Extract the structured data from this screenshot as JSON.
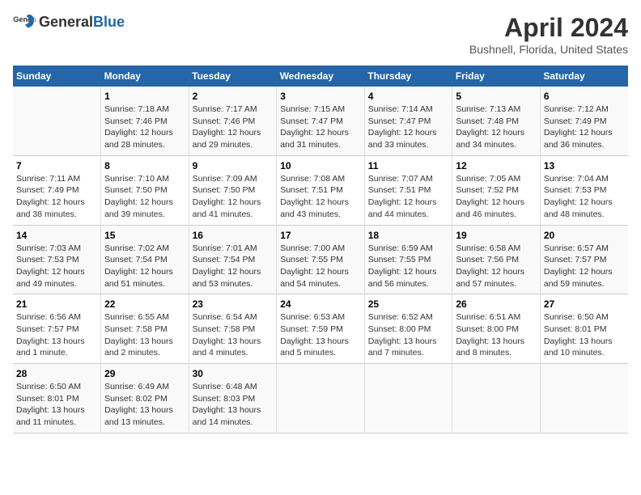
{
  "header": {
    "logo_general": "General",
    "logo_blue": "Blue",
    "title": "April 2024",
    "subtitle": "Bushnell, Florida, United States"
  },
  "days_of_week": [
    "Sunday",
    "Monday",
    "Tuesday",
    "Wednesday",
    "Thursday",
    "Friday",
    "Saturday"
  ],
  "weeks": [
    [
      {
        "day": "",
        "sunrise": "",
        "sunset": "",
        "daylight": ""
      },
      {
        "day": "1",
        "sunrise": "Sunrise: 7:18 AM",
        "sunset": "Sunset: 7:46 PM",
        "daylight": "Daylight: 12 hours and 28 minutes."
      },
      {
        "day": "2",
        "sunrise": "Sunrise: 7:17 AM",
        "sunset": "Sunset: 7:46 PM",
        "daylight": "Daylight: 12 hours and 29 minutes."
      },
      {
        "day": "3",
        "sunrise": "Sunrise: 7:15 AM",
        "sunset": "Sunset: 7:47 PM",
        "daylight": "Daylight: 12 hours and 31 minutes."
      },
      {
        "day": "4",
        "sunrise": "Sunrise: 7:14 AM",
        "sunset": "Sunset: 7:47 PM",
        "daylight": "Daylight: 12 hours and 33 minutes."
      },
      {
        "day": "5",
        "sunrise": "Sunrise: 7:13 AM",
        "sunset": "Sunset: 7:48 PM",
        "daylight": "Daylight: 12 hours and 34 minutes."
      },
      {
        "day": "6",
        "sunrise": "Sunrise: 7:12 AM",
        "sunset": "Sunset: 7:49 PM",
        "daylight": "Daylight: 12 hours and 36 minutes."
      }
    ],
    [
      {
        "day": "7",
        "sunrise": "Sunrise: 7:11 AM",
        "sunset": "Sunset: 7:49 PM",
        "daylight": "Daylight: 12 hours and 38 minutes."
      },
      {
        "day": "8",
        "sunrise": "Sunrise: 7:10 AM",
        "sunset": "Sunset: 7:50 PM",
        "daylight": "Daylight: 12 hours and 39 minutes."
      },
      {
        "day": "9",
        "sunrise": "Sunrise: 7:09 AM",
        "sunset": "Sunset: 7:50 PM",
        "daylight": "Daylight: 12 hours and 41 minutes."
      },
      {
        "day": "10",
        "sunrise": "Sunrise: 7:08 AM",
        "sunset": "Sunset: 7:51 PM",
        "daylight": "Daylight: 12 hours and 43 minutes."
      },
      {
        "day": "11",
        "sunrise": "Sunrise: 7:07 AM",
        "sunset": "Sunset: 7:51 PM",
        "daylight": "Daylight: 12 hours and 44 minutes."
      },
      {
        "day": "12",
        "sunrise": "Sunrise: 7:05 AM",
        "sunset": "Sunset: 7:52 PM",
        "daylight": "Daylight: 12 hours and 46 minutes."
      },
      {
        "day": "13",
        "sunrise": "Sunrise: 7:04 AM",
        "sunset": "Sunset: 7:53 PM",
        "daylight": "Daylight: 12 hours and 48 minutes."
      }
    ],
    [
      {
        "day": "14",
        "sunrise": "Sunrise: 7:03 AM",
        "sunset": "Sunset: 7:53 PM",
        "daylight": "Daylight: 12 hours and 49 minutes."
      },
      {
        "day": "15",
        "sunrise": "Sunrise: 7:02 AM",
        "sunset": "Sunset: 7:54 PM",
        "daylight": "Daylight: 12 hours and 51 minutes."
      },
      {
        "day": "16",
        "sunrise": "Sunrise: 7:01 AM",
        "sunset": "Sunset: 7:54 PM",
        "daylight": "Daylight: 12 hours and 53 minutes."
      },
      {
        "day": "17",
        "sunrise": "Sunrise: 7:00 AM",
        "sunset": "Sunset: 7:55 PM",
        "daylight": "Daylight: 12 hours and 54 minutes."
      },
      {
        "day": "18",
        "sunrise": "Sunrise: 6:59 AM",
        "sunset": "Sunset: 7:55 PM",
        "daylight": "Daylight: 12 hours and 56 minutes."
      },
      {
        "day": "19",
        "sunrise": "Sunrise: 6:58 AM",
        "sunset": "Sunset: 7:56 PM",
        "daylight": "Daylight: 12 hours and 57 minutes."
      },
      {
        "day": "20",
        "sunrise": "Sunrise: 6:57 AM",
        "sunset": "Sunset: 7:57 PM",
        "daylight": "Daylight: 12 hours and 59 minutes."
      }
    ],
    [
      {
        "day": "21",
        "sunrise": "Sunrise: 6:56 AM",
        "sunset": "Sunset: 7:57 PM",
        "daylight": "Daylight: 13 hours and 1 minute."
      },
      {
        "day": "22",
        "sunrise": "Sunrise: 6:55 AM",
        "sunset": "Sunset: 7:58 PM",
        "daylight": "Daylight: 13 hours and 2 minutes."
      },
      {
        "day": "23",
        "sunrise": "Sunrise: 6:54 AM",
        "sunset": "Sunset: 7:58 PM",
        "daylight": "Daylight: 13 hours and 4 minutes."
      },
      {
        "day": "24",
        "sunrise": "Sunrise: 6:53 AM",
        "sunset": "Sunset: 7:59 PM",
        "daylight": "Daylight: 13 hours and 5 minutes."
      },
      {
        "day": "25",
        "sunrise": "Sunrise: 6:52 AM",
        "sunset": "Sunset: 8:00 PM",
        "daylight": "Daylight: 13 hours and 7 minutes."
      },
      {
        "day": "26",
        "sunrise": "Sunrise: 6:51 AM",
        "sunset": "Sunset: 8:00 PM",
        "daylight": "Daylight: 13 hours and 8 minutes."
      },
      {
        "day": "27",
        "sunrise": "Sunrise: 6:50 AM",
        "sunset": "Sunset: 8:01 PM",
        "daylight": "Daylight: 13 hours and 10 minutes."
      }
    ],
    [
      {
        "day": "28",
        "sunrise": "Sunrise: 6:50 AM",
        "sunset": "Sunset: 8:01 PM",
        "daylight": "Daylight: 13 hours and 11 minutes."
      },
      {
        "day": "29",
        "sunrise": "Sunrise: 6:49 AM",
        "sunset": "Sunset: 8:02 PM",
        "daylight": "Daylight: 13 hours and 13 minutes."
      },
      {
        "day": "30",
        "sunrise": "Sunrise: 6:48 AM",
        "sunset": "Sunset: 8:03 PM",
        "daylight": "Daylight: 13 hours and 14 minutes."
      },
      {
        "day": "",
        "sunrise": "",
        "sunset": "",
        "daylight": ""
      },
      {
        "day": "",
        "sunrise": "",
        "sunset": "",
        "daylight": ""
      },
      {
        "day": "",
        "sunrise": "",
        "sunset": "",
        "daylight": ""
      },
      {
        "day": "",
        "sunrise": "",
        "sunset": "",
        "daylight": ""
      }
    ]
  ]
}
